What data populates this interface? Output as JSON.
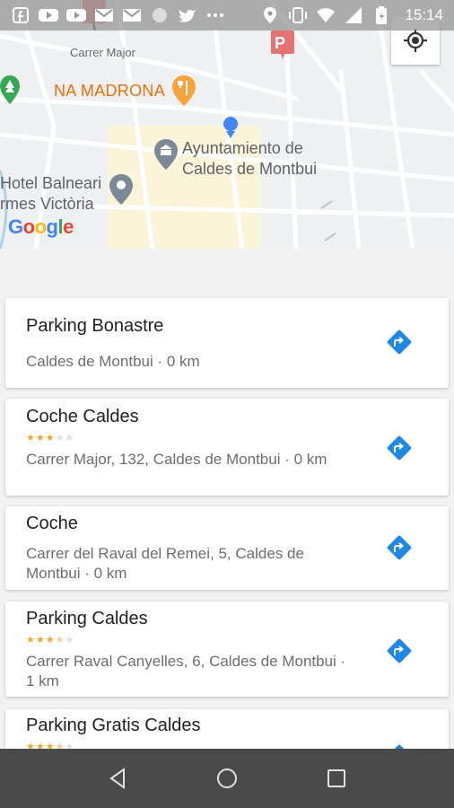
{
  "status_bar": {
    "time": "15:14",
    "left_icons": [
      "facebook-icon",
      "youtube-icon",
      "youtube-icon",
      "gmail-icon",
      "gmail-icon",
      "circle-icon",
      "twitter-icon",
      "more-icon"
    ],
    "right_icons": [
      "location-icon",
      "vibrate-icon",
      "wifi-icon",
      "signal-icon",
      "battery-icon"
    ]
  },
  "map": {
    "labels": {
      "street": "Carrer Major",
      "restaurant": "NA MADRONA",
      "townhall_line1": "Ayuntamiento de",
      "townhall_line2": "Caldes de Montbui",
      "hotel_line1": "Hotel Balneari",
      "hotel_line2": "rmes Victòria"
    },
    "logo": "Google",
    "colors": {
      "restaurant": "#e8710a",
      "user_dot": "#4285f4",
      "parking_marker": "#e57373"
    }
  },
  "places": [
    {
      "name": "Parking Bonastre",
      "address": "Caldes de Montbui · 0 km",
      "rating": null
    },
    {
      "name": "Coche Caldes",
      "address": "Carrer Major, 132, Caldes de Montbui · 0 km",
      "rating": 3
    },
    {
      "name": "Coche",
      "address": "Carrer del Raval del Remei, 5, Caldes de Montbui · 0 km",
      "rating": null
    },
    {
      "name": "Parking Caldes",
      "address": "Carrer Raval Canyelles, 6, Caldes de Montbui · 1 km",
      "rating": 3.5
    },
    {
      "name": "Parking Gratis Caldes",
      "address": "",
      "rating": 3.5
    }
  ],
  "colors": {
    "accent": "#1e88e5",
    "star": "#f5a623",
    "nav_bar": "#4a4a4a"
  },
  "nav_bar": {
    "buttons": [
      "back-icon",
      "home-icon",
      "recents-icon"
    ]
  }
}
